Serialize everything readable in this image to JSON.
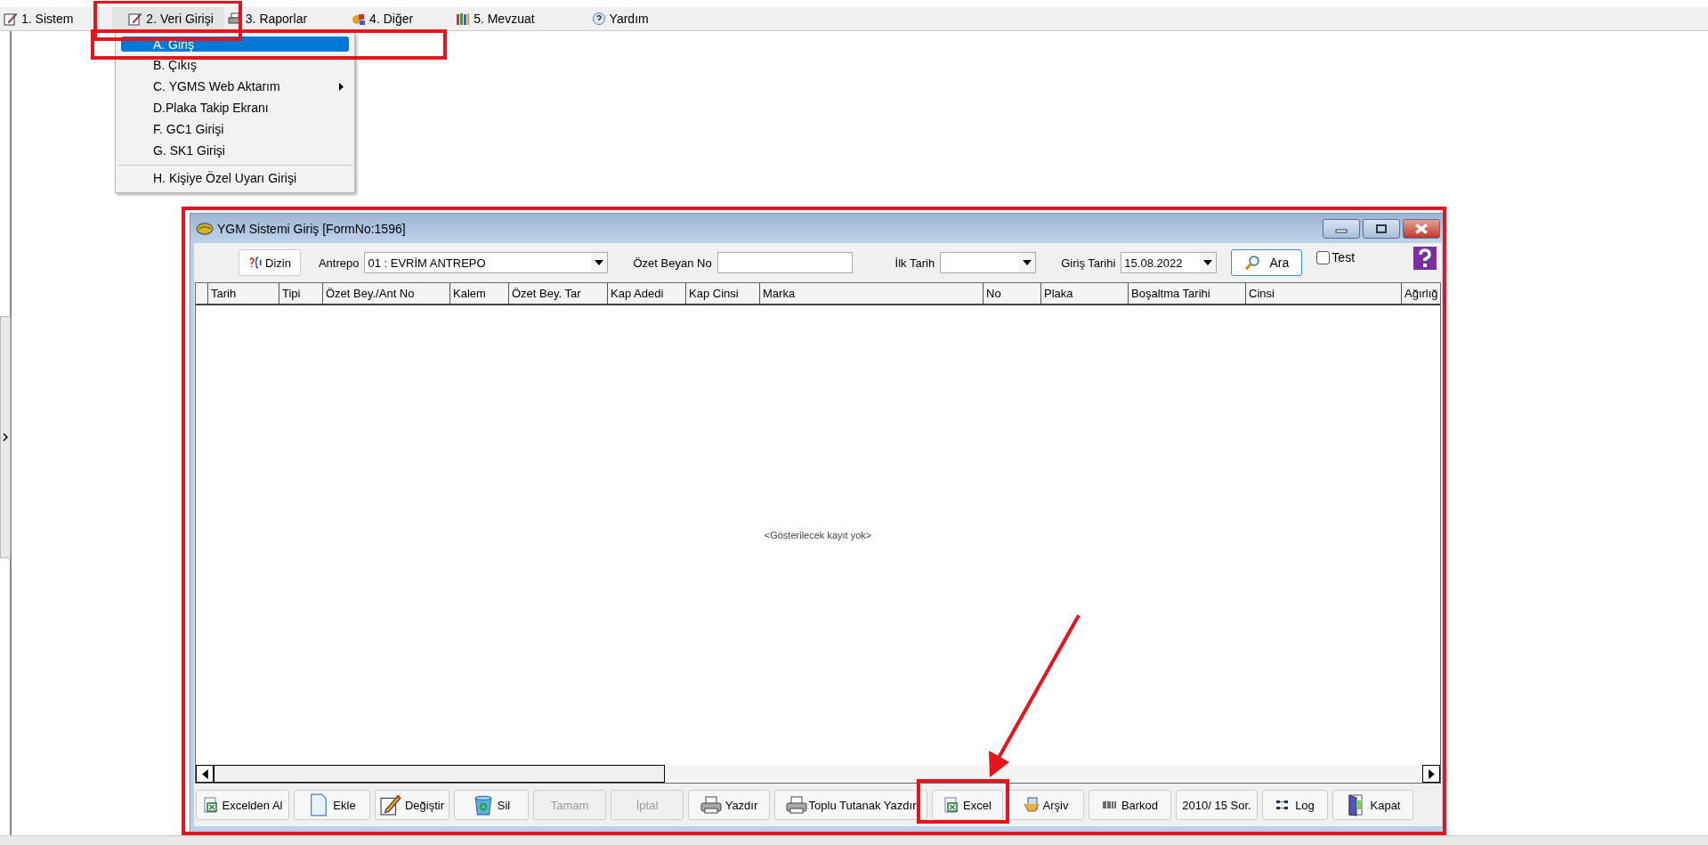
{
  "menu_bar": [
    {
      "label": "1.  Sistem",
      "selected": false
    },
    {
      "label": "2.  Veri Girişi",
      "selected": true
    },
    {
      "label": "3. Raporlar",
      "selected": false
    },
    {
      "label": "4. Diğer",
      "selected": false
    },
    {
      "label": "5. Mevzuat",
      "selected": false
    },
    {
      "label": "Yardım",
      "selected": false
    }
  ],
  "dropdown": [
    {
      "label": "A. Giriş",
      "selected": true,
      "submenu": false,
      "separator_before": false
    },
    {
      "label": "B. Çıkış",
      "selected": false,
      "submenu": false,
      "separator_before": false
    },
    {
      "label": "C. YGMS Web Aktarım",
      "selected": false,
      "submenu": true,
      "separator_before": false
    },
    {
      "label": "D.Plaka Takip Ekranı",
      "selected": false,
      "submenu": false,
      "separator_before": false
    },
    {
      "label": "F. GC1 Girişi",
      "selected": false,
      "submenu": false,
      "separator_before": false
    },
    {
      "label": "G. SK1 Girişi",
      "selected": false,
      "submenu": false,
      "separator_before": false
    },
    {
      "label": "H. Kişiye Özel Uyarı Girişi",
      "selected": false,
      "submenu": false,
      "separator_before": true
    }
  ],
  "window": {
    "title": "YGM Sistemi Giriş [FormNo:1596]",
    "toolbar": {
      "dizin": "Dizin",
      "antrepo_label": "Antrepo",
      "antrepo_value": "01 : EVRİM ANTREPO",
      "ozet_label": "Özet Beyan No",
      "ilk_label": "İlk Tarih",
      "giris_label": "Giriş Tarihi",
      "giris_value": "15.08.2022",
      "search": "Ara",
      "test": {
        "label": "Test",
        "checked": false
      }
    },
    "table": {
      "columns": [
        "Tarih",
        "Tipi",
        "Özet Bey./Ant No",
        "Kalem",
        "Özet Bey. Tar",
        "Kap Adedi",
        "Kap Cinsi",
        "Marka",
        "No",
        "Plaka",
        "Boşaltma Tarihi",
        "Cinsi",
        "Ağırlığ"
      ],
      "empty_message": "<Gösterilecek kayıt yok>"
    },
    "buttons": [
      {
        "label": "Excelden Al",
        "kind": "excel",
        "disabled": false
      },
      {
        "label": "Ekle",
        "kind": "doc",
        "disabled": false
      },
      {
        "label": "Değiştir",
        "kind": "pencil",
        "disabled": false
      },
      {
        "label": "Sil",
        "kind": "bin",
        "disabled": false
      },
      {
        "label": "Tamam",
        "kind": "plain",
        "disabled": true
      },
      {
        "label": "İptal",
        "kind": "plain",
        "disabled": true
      },
      {
        "label": "Yazdır",
        "kind": "printer",
        "disabled": false
      },
      {
        "label": "Toplu Tutanak Yazdır",
        "kind": "printer",
        "disabled": false
      },
      {
        "label": "Excel",
        "kind": "excel",
        "disabled": false
      },
      {
        "label": "Arşiv",
        "kind": "archive",
        "disabled": false
      },
      {
        "label": "Barkod",
        "kind": "barcode",
        "disabled": false
      },
      {
        "label": "2010/ 15 Sor.",
        "kind": "plain",
        "disabled": false
      },
      {
        "label": "Log",
        "kind": "log",
        "disabled": false
      },
      {
        "label": "Kapat",
        "kind": "door",
        "disabled": false
      }
    ]
  }
}
